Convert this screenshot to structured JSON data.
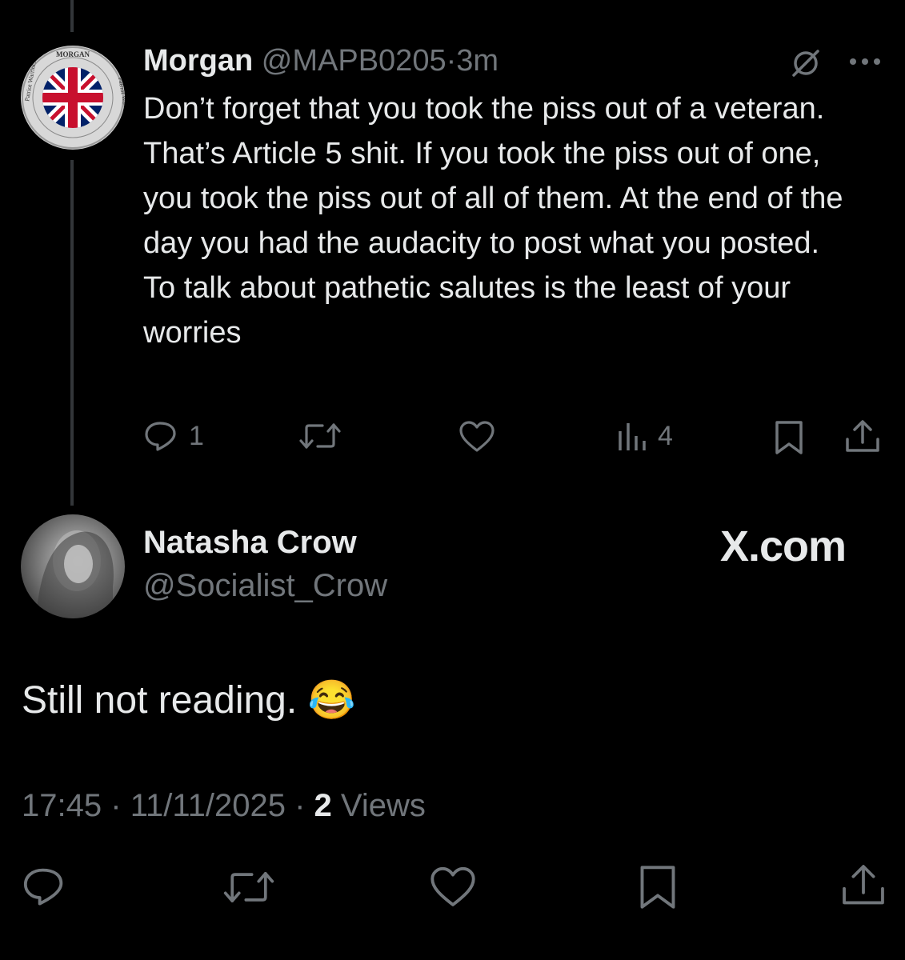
{
  "parent_tweet": {
    "author_name": "Morgan",
    "handle": "@MAPB0205",
    "separator": "·",
    "time": "3m",
    "avatar_text_top": "MORGAN",
    "avatar_text_left": "Patriot Warriors",
    "avatar_text_right": "Patriot Warriors",
    "text": "Don’t forget that you took the piss out of a veteran. That’s Article 5 shit. If you took the piss out of one, you took the piss out of all of them. At the end of the day you had the audacity to post what you posted. To talk about pathetic salutes is the least of your worries",
    "actions": {
      "reply_count": "1",
      "repost_count": "",
      "like_count": "",
      "views_count": "4"
    }
  },
  "reply_tweet": {
    "author_name": "Natasha Crow",
    "handle": "@Socialist_Crow",
    "brand": "X.com",
    "text": "Still not reading.",
    "emoji": "😂",
    "time": "17:45",
    "date": "11/11/2025",
    "separator": "·",
    "views_count": "2",
    "views_label": "Views"
  },
  "colors": {
    "background": "#000000",
    "text": "#e7e9ea",
    "muted": "#71767b",
    "thread_line": "#333639"
  }
}
